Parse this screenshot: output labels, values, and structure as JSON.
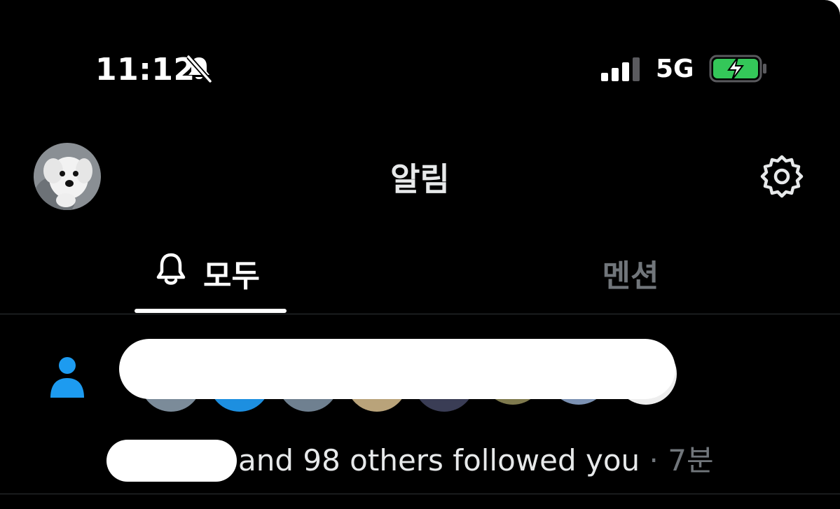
{
  "status_bar": {
    "time": "11:12",
    "network": "5G",
    "icons": [
      "bell-slash-icon",
      "signal-bars-icon",
      "battery-charging-icon"
    ],
    "battery_color": "#34c759"
  },
  "header": {
    "title": "알림",
    "avatar_icon": "profile-avatar",
    "settings_icon": "gear-icon"
  },
  "tabs": [
    {
      "label": "모두",
      "icon": "bell-icon",
      "active": true
    },
    {
      "label": "멘션",
      "active": false
    }
  ],
  "notification": {
    "type_icon": "person-icon",
    "accent_color": "#1d9bf0",
    "text": "and 98 others followed you",
    "separator": "·",
    "time": "7분"
  }
}
